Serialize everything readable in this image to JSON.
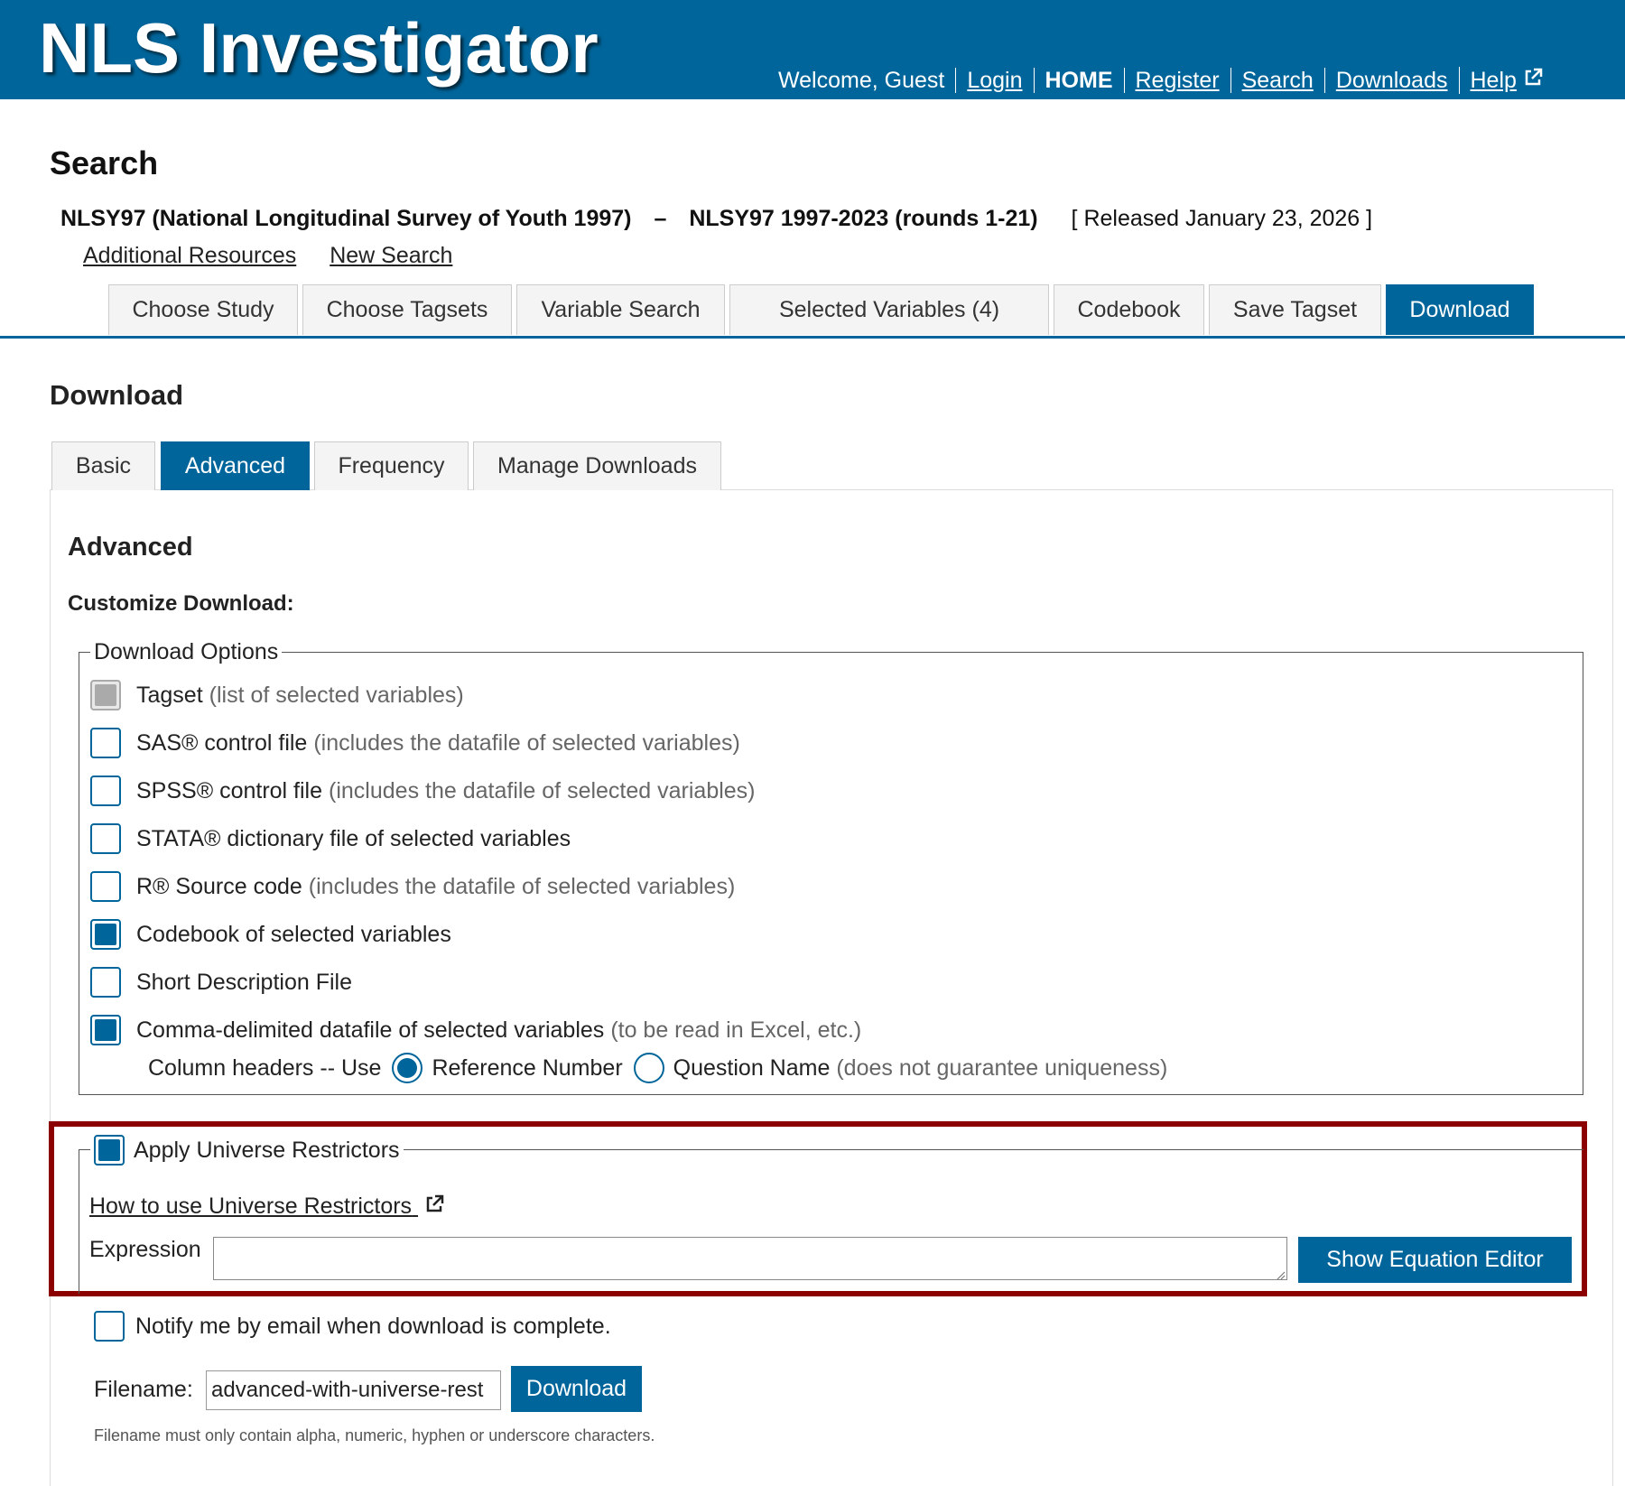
{
  "header": {
    "logo": "NLS Investigator",
    "welcome": "Welcome, Guest",
    "nav": {
      "login": "Login",
      "home": "HOME",
      "register": "Register",
      "search": "Search",
      "downloads": "Downloads",
      "help": "Help"
    },
    "help_icon": "external-link-icon"
  },
  "page": {
    "title": "Search",
    "study_name": "NLSY97 (National Longitudinal Survey of Youth 1997)",
    "separator": "–",
    "study_range": "NLSY97 1997-2023 (rounds 1-21)",
    "released": "[ Released January 23, 2026 ]",
    "links": {
      "additional_resources": "Additional Resources",
      "new_search": "New Search"
    }
  },
  "main_tabs": {
    "choose_study": "Choose Study",
    "choose_tagsets": "Choose Tagsets",
    "variable_search": "Variable Search",
    "selected_variables": "Selected Variables (4)",
    "codebook": "Codebook",
    "save_tagset": "Save Tagset",
    "download": "Download",
    "active": "Download"
  },
  "download": {
    "title": "Download",
    "sub_tabs": {
      "basic": "Basic",
      "advanced": "Advanced",
      "frequency": "Frequency",
      "manage": "Manage Downloads",
      "active": "Advanced"
    },
    "advanced_title": "Advanced",
    "customize_label": "Customize Download:",
    "options_legend": "Download Options",
    "options": [
      {
        "label": "Tagset",
        "note": "(list of selected variables)",
        "checked": true,
        "disabled": true
      },
      {
        "label": "SAS® control file",
        "note": "(includes the datafile of selected variables)",
        "checked": false
      },
      {
        "label": "SPSS® control file",
        "note": "(includes the datafile of selected variables)",
        "checked": false
      },
      {
        "label": "STATA® dictionary file of selected variables",
        "note": "",
        "checked": false
      },
      {
        "label": "R® Source code",
        "note": "(includes the datafile of selected variables)",
        "checked": false
      },
      {
        "label": "Codebook of selected variables",
        "note": "",
        "checked": true
      },
      {
        "label": "Short Description File",
        "note": "",
        "checked": false
      },
      {
        "label": "Comma-delimited datafile of selected variables",
        "note": "(to be read in Excel, etc.)",
        "checked": true
      }
    ],
    "column_headers": {
      "label": "Column headers -- Use",
      "ref_number": "Reference Number",
      "question_name": "Question Name",
      "question_note": "(does not guarantee uniqueness)",
      "selected": "Reference Number"
    },
    "universe": {
      "legend": "Apply Universe Restrictors",
      "checked": true,
      "howto_link": "How to use Universe Restrictors",
      "expression_label": "Expression",
      "expression_value": "",
      "equation_button": "Show Equation Editor"
    },
    "notify": {
      "label": "Notify me by email when download is complete.",
      "checked": false
    },
    "filename": {
      "label": "Filename:",
      "value": "advanced-with-universe-rest",
      "button": "Download",
      "hint": "Filename must only contain alpha, numeric, hyphen or underscore characters."
    }
  },
  "colors": {
    "primary": "#00659a",
    "highlight": "#8b0000"
  }
}
